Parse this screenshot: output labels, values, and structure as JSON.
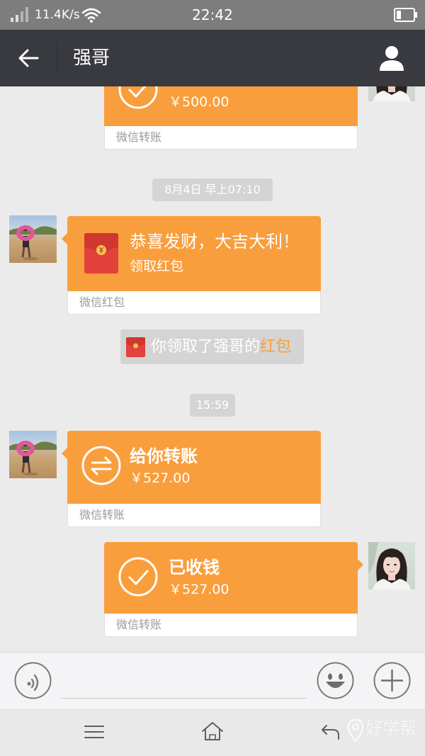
{
  "status_bar": {
    "network_speed": "11.4K/s",
    "time": "22:42"
  },
  "header": {
    "title": "强哥"
  },
  "messages": {
    "transfer_earlier": {
      "amount": "￥500.00",
      "footer": "微信转账"
    },
    "timestamp_morning": "8月4日 早上07:10",
    "red_packet": {
      "greeting": "恭喜发财，大吉大利！",
      "action": "领取红包",
      "footer": "微信红包"
    },
    "system_notice": {
      "text": "你领取了强哥的",
      "link": "红包"
    },
    "timestamp_afternoon": "15:59",
    "transfer_incoming": {
      "title": "给你转账",
      "amount": "￥527.00",
      "footer": "微信转账"
    },
    "transfer_accepted": {
      "title": "已收钱",
      "amount": "￥527.00",
      "footer": "微信转账"
    }
  },
  "watermark": {
    "text": "好学帮"
  },
  "icons": {
    "signal": "signal-icon",
    "wifi": "wifi-icon",
    "battery": "battery-icon",
    "back": "back-arrow-icon",
    "profile": "person-icon",
    "accepted": "check-circle-icon",
    "transfer": "transfer-arrows-icon",
    "red_packet": "red-envelope-icon",
    "voice": "voice-icon",
    "emoji": "emoji-icon",
    "more": "plus-icon",
    "nav_menu": "menu-icon",
    "nav_home": "home-icon",
    "nav_back": "return-icon"
  },
  "colors": {
    "header_background": "#393a3f",
    "card_orange": "#f99e3d",
    "chat_background": "#ebebeb"
  }
}
